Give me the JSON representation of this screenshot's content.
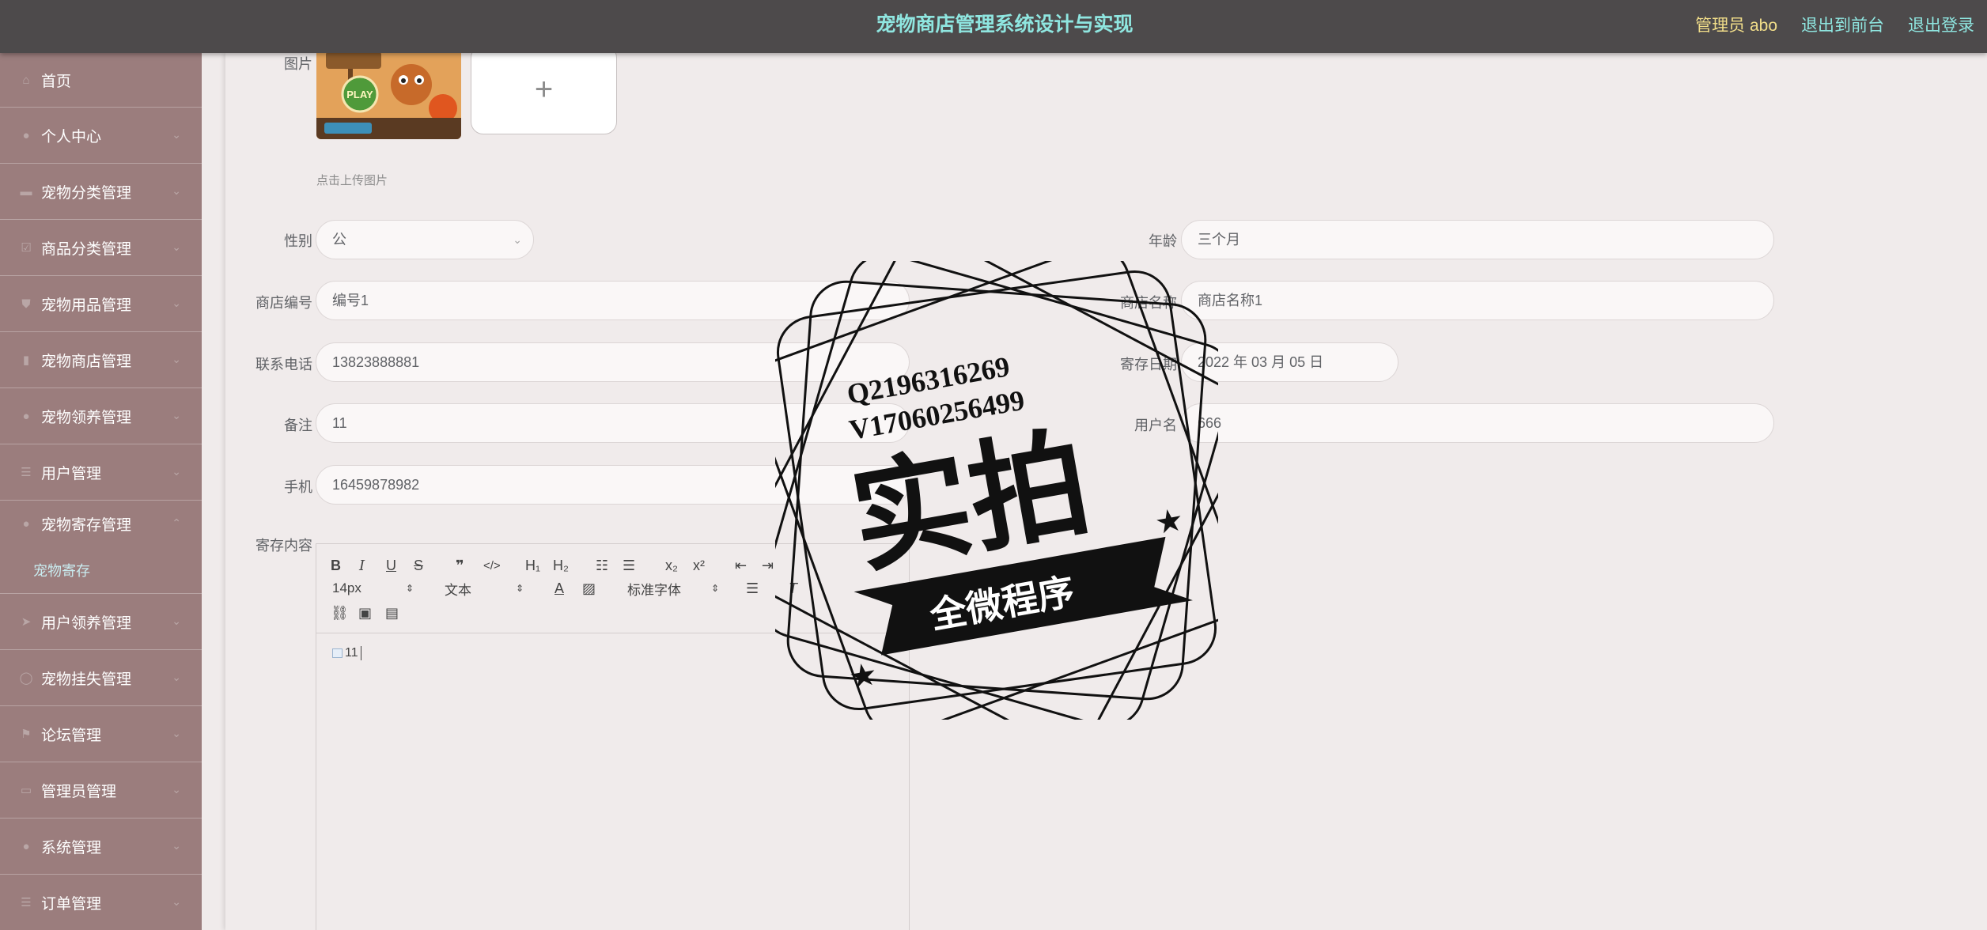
{
  "header": {
    "title": "宠物商店管理系统设计与实现",
    "admin_label": "管理员 abo",
    "to_front": "退出到前台",
    "logout": "退出登录"
  },
  "sidebar": {
    "items": [
      {
        "label": "首页",
        "icon": "home-icon"
      },
      {
        "label": "个人中心",
        "icon": "user-icon"
      },
      {
        "label": "宠物分类管理",
        "icon": "grid-icon"
      },
      {
        "label": "商品分类管理",
        "icon": "list-icon"
      },
      {
        "label": "宠物用品管理",
        "icon": "shield-icon"
      },
      {
        "label": "宠物商店管理",
        "icon": "bar-chart-icon"
      },
      {
        "label": "宠物领养管理",
        "icon": "user-icon"
      },
      {
        "label": "用户管理",
        "icon": "menu-icon"
      },
      {
        "label": "宠物寄存管理",
        "icon": "user-icon"
      },
      {
        "label": "用户领养管理",
        "icon": "send-icon"
      },
      {
        "label": "宠物挂失管理",
        "icon": "circle-icon"
      },
      {
        "label": "论坛管理",
        "icon": "flag-icon"
      },
      {
        "label": "管理员管理",
        "icon": "card-icon"
      },
      {
        "label": "系统管理",
        "icon": "pin-icon"
      },
      {
        "label": "订单管理",
        "icon": "menu-icon"
      }
    ],
    "submenu_active": "宠物寄存"
  },
  "form": {
    "image_label": "图片",
    "upload_plus": "+",
    "upload_hint": "点击上传图片",
    "thumb_text": "PLAY",
    "gender_label": "性别",
    "gender_value": "公",
    "age_label": "年龄",
    "age_value": "三个月",
    "shop_no_label": "商店编号",
    "shop_no_value": "编号1",
    "shop_name_label": "商店名称",
    "shop_name_value": "商店名称1",
    "phone_label": "联系电话",
    "phone_value": "13823888881",
    "date_label": "寄存日期",
    "date_value": "2022 年 03 月 05 日",
    "note_label": "备注",
    "note_value": "11",
    "username_label": "用户名",
    "username_value": "666",
    "mobile_label": "手机",
    "mobile_value": "16459878982",
    "content_label": "寄存内容"
  },
  "editor": {
    "size_value": "14px",
    "text_type": "文本",
    "font_family": "标准字体",
    "body_alt": "11"
  },
  "watermark": {
    "line1": "Q2196316269",
    "line2": "V17060256499",
    "big": "实拍",
    "banner": "全微程序"
  }
}
